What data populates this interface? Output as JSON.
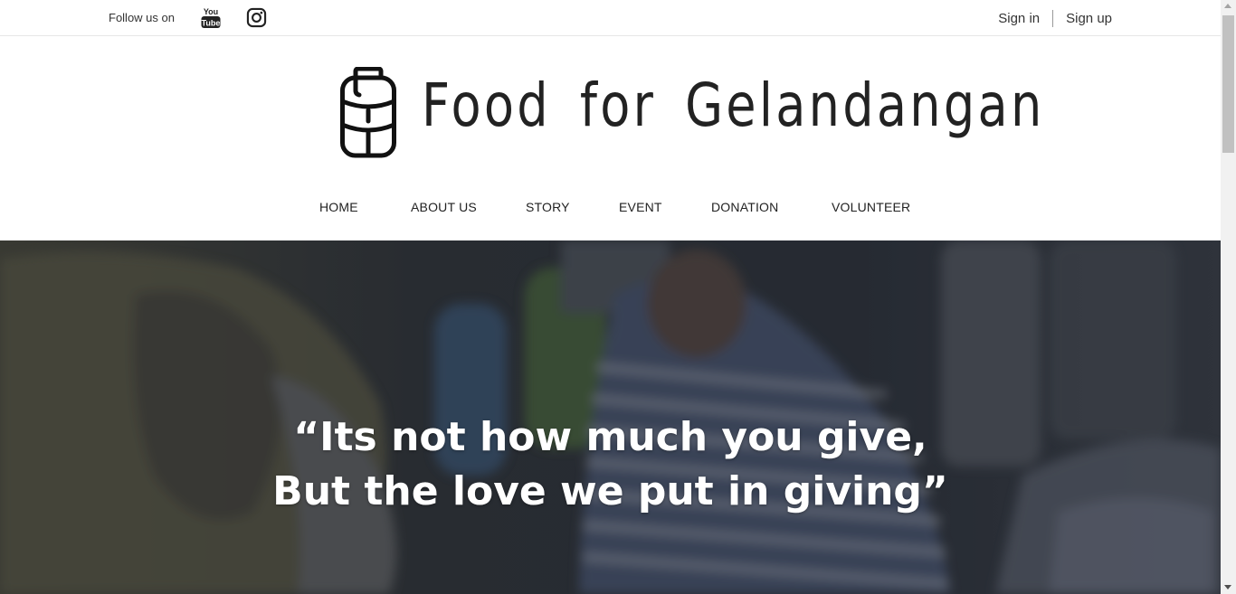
{
  "topbar": {
    "follow_text": "Follow us on",
    "social_icons": [
      "youtube-icon",
      "instagram-icon"
    ],
    "sign_in": "Sign in",
    "sign_up": "Sign up"
  },
  "brand": {
    "name": "Food for Gelandangan",
    "logo_icon": "tiffin-carrier-icon"
  },
  "nav": {
    "items": [
      {
        "label": "HOME"
      },
      {
        "label": "ABOUT US"
      },
      {
        "label": "STORY"
      },
      {
        "label": "EVENT"
      },
      {
        "label": "DONATION"
      },
      {
        "label": "VOLUNTEER"
      }
    ]
  },
  "hero": {
    "quote_line1": "“Its not how much you give,",
    "quote_line2": "But the love we put in giving”"
  },
  "colors": {
    "text": "#222222",
    "hero_text": "#ffffff",
    "hero_overlay": "#2b2f37"
  }
}
